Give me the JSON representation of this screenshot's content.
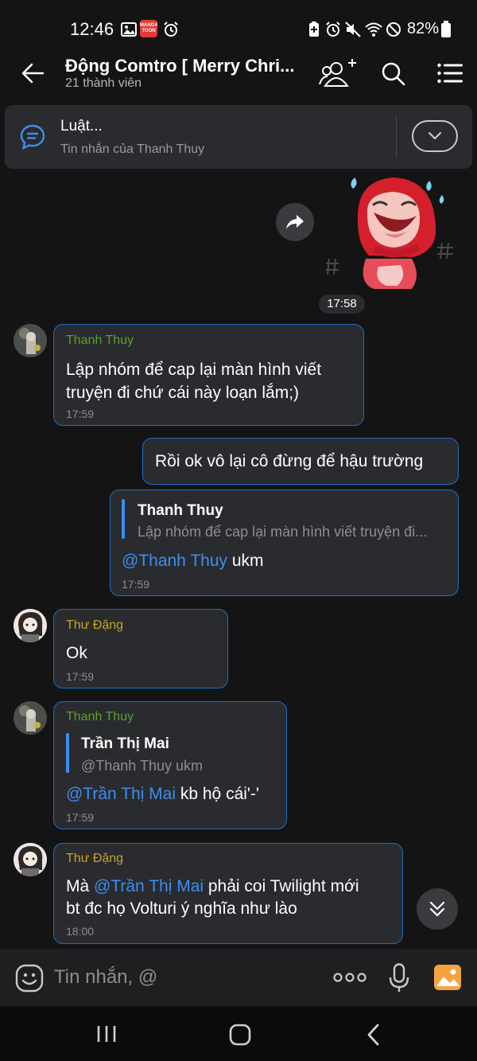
{
  "status_bar": {
    "time": "12:46",
    "battery": "82%",
    "manga_badge_text": "MANGA TOON"
  },
  "header": {
    "title": "Động Comtro [ Merry Chri...",
    "subtitle": "21 thành viên"
  },
  "pinned": {
    "title": "Luật...",
    "subtitle": "Tin nhắn của Thanh Thuy"
  },
  "sticker_time": "17:58",
  "messages": [
    {
      "sender": "Thanh Thuy",
      "line1": "Lập nhóm để cap lại màn hình viết",
      "line2": "truyện đi chứ cái này loạn lắm;)",
      "time": "17:59"
    },
    {
      "text": "Rồi ok vô lại cô đừng để hậu trường"
    },
    {
      "quote_name": "Thanh Thuy",
      "quote_text": "Lập nhóm để cap lại màn hình viết truyện đi...",
      "mention": "@Thanh Thuy",
      "rest": " ukm",
      "time": "17:59"
    },
    {
      "sender": "Thư Đặng",
      "text": "Ok",
      "time": "17:59"
    },
    {
      "sender": "Thanh Thuy",
      "quote_name": "Trần Thị Mai",
      "quote_text": "@Thanh Thuy ukm",
      "mention": "@Trần Thị Mai",
      "rest": " kb hộ cái'-'",
      "time": "17:59"
    },
    {
      "sender": "Thư Đặng",
      "pre": "Mà ",
      "mention": "@Trần Thị Mai",
      "rest1": " phải coi Twilight mới",
      "line2": "bt đc họ Volturi ý nghĩa như lào",
      "time": "18:00"
    }
  ],
  "input": {
    "placeholder": "Tin nhắn, @"
  },
  "colors": {
    "background": "#141414",
    "bubble": "#2a2b2e",
    "bubble_border": "#1d6fc4",
    "mention": "#3d8ef0",
    "sender_green": "#5aa02c",
    "sender_gold": "#c9a227"
  },
  "icons": [
    "back-arrow-icon",
    "add-member-icon",
    "search-icon",
    "menu-icon",
    "pinned-message-icon",
    "chevron-down-icon",
    "forward-icon",
    "double-chevron-down-icon",
    "emoji-icon",
    "more-icon",
    "microphone-icon",
    "gallery-icon"
  ]
}
